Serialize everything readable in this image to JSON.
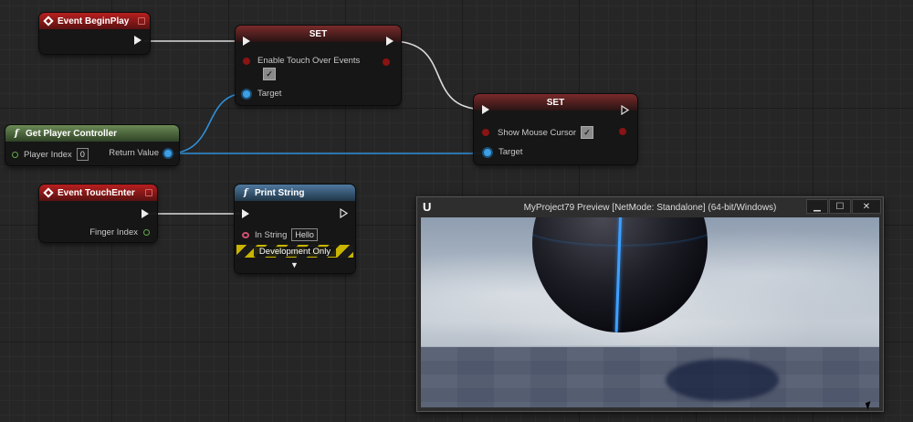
{
  "nodes": {
    "begin_play": {
      "title": "Event BeginPlay"
    },
    "set1": {
      "title": "SET",
      "var_label": "Enable Touch Over Events",
      "target_label": "Target"
    },
    "set2": {
      "title": "SET",
      "var_label": "Show Mouse Cursor",
      "target_label": "Target"
    },
    "get_pc": {
      "title": "Get Player Controller",
      "index_label": "Player Index",
      "index_value": "0",
      "return_label": "Return Value"
    },
    "touch_enter": {
      "title": "Event TouchEnter",
      "finger_label": "Finger Index"
    },
    "print_string": {
      "title": "Print String",
      "in_label": "In String",
      "in_value": "Hello",
      "dev_label": "Development Only"
    }
  },
  "preview": {
    "title": "MyProject79 Preview [NetMode: Standalone] (64-bit/Windows)",
    "btn_min": "▁",
    "btn_max": "☐",
    "btn_close": "✕"
  },
  "colors": {
    "event_header": "#b81f1f",
    "pure_function_header": "#6b8a55",
    "function_header": "#4f79a0",
    "object_wire": "#3da0e6",
    "exec_wire": "#e0e0e0"
  }
}
